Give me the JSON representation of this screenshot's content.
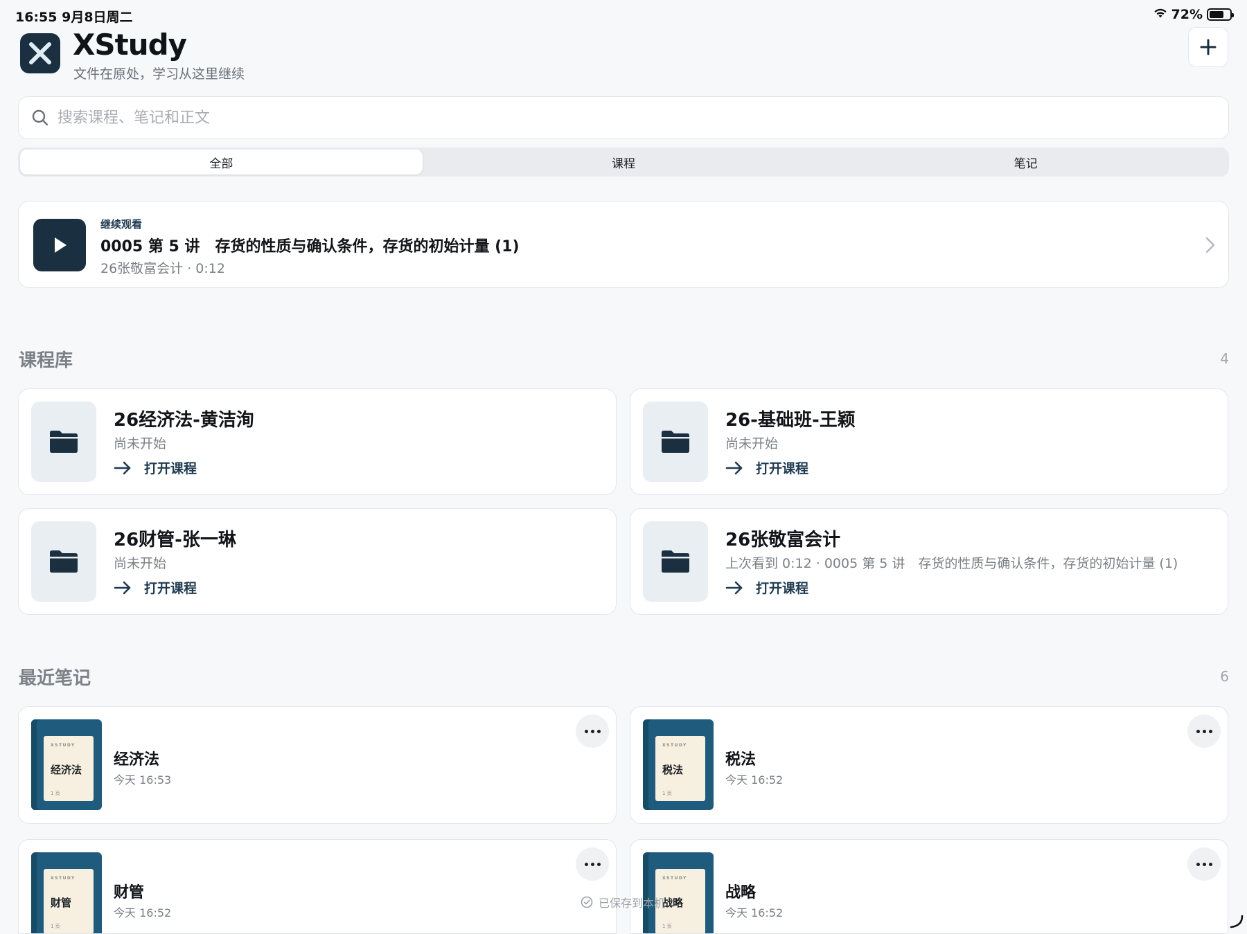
{
  "status_bar": {
    "time_date": "16:55  9月8日周二",
    "battery": "72%",
    "battery_level": 0.72,
    "wifi_icon": "wifi-icon",
    "battery_icon": "battery-icon"
  },
  "header": {
    "title": "XStudy",
    "subtitle": "文件在原处，学习从这里继续",
    "add_icon": "plus-icon"
  },
  "search": {
    "placeholder": "搜索课程、笔记和正文",
    "value": ""
  },
  "tabs": [
    {
      "label": "全部",
      "active": true
    },
    {
      "label": "课程",
      "active": false
    },
    {
      "label": "笔记",
      "active": false
    }
  ],
  "continue_watching": {
    "eyebrow": "继续观看",
    "title": "0005 第 5 讲　存货的性质与确认条件，存货的初始计量 (1)",
    "meta": "26张敬富会计 · 0:12"
  },
  "library": {
    "title": "课程库",
    "count": "4",
    "open_label": "打开课程",
    "courses": [
      {
        "title": "26经济法-黄洁洵",
        "status": "尚未开始"
      },
      {
        "title": "26-基础班-王颖",
        "status": "尚未开始"
      },
      {
        "title": "26财管-张一琳",
        "status": "尚未开始"
      },
      {
        "title": "26张敬富会计",
        "status": "上次看到 0:12 · 0005 第 5 讲　存货的性质与确认条件，存货的初始计量 (1)"
      }
    ]
  },
  "notes": {
    "title": "最近笔记",
    "count": "6",
    "cover_brand": "XSTUDY",
    "cover_pages": "1 页",
    "items": [
      {
        "title": "经济法",
        "time": "今天 16:53"
      },
      {
        "title": "税法",
        "time": "今天 16:52"
      },
      {
        "title": "财管",
        "time": "今天 16:52"
      },
      {
        "title": "战略",
        "time": "今天 16:52"
      }
    ]
  },
  "toast": "已保存到本机",
  "colors": {
    "brand_dark": "#1a3041",
    "accent": "#1f3b52",
    "notebook_blue": "#1e5b7d",
    "background": "#f7f8fa"
  }
}
